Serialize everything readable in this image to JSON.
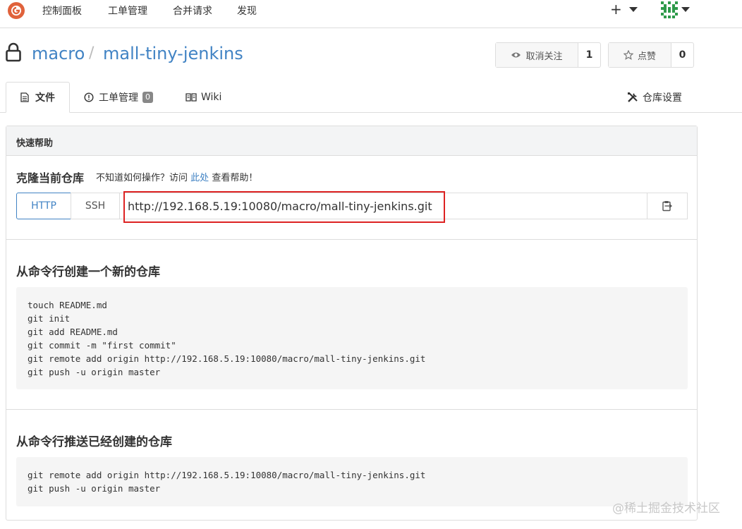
{
  "nav": {
    "items": [
      "控制面板",
      "工单管理",
      "合并请求",
      "发现"
    ],
    "plus": "+"
  },
  "repo": {
    "owner": "macro",
    "separator": "/",
    "name": "mall-tiny-jenkins"
  },
  "actions": {
    "watch_label": "取消关注",
    "watch_count": "1",
    "star_label": "点赞",
    "star_count": "0"
  },
  "tabs": {
    "files": "文件",
    "issues": "工单管理",
    "issues_count": "0",
    "wiki": "Wiki",
    "settings": "仓库设置"
  },
  "quick_help": {
    "header": "快速帮助",
    "clone_title": "克隆当前仓库",
    "hint_prefix": "不知道如何操作？访问",
    "hint_link": "此处",
    "hint_suffix": "查看帮助！",
    "protocols": [
      "HTTP",
      "SSH"
    ],
    "active_protocol": "HTTP",
    "clone_url": "http://192.168.5.19:10080/macro/mall-tiny-jenkins.git"
  },
  "new_repo": {
    "title": "从命令行创建一个新的仓库",
    "lines": [
      "touch README.md",
      "git init",
      "git add README.md",
      "git commit -m \"first commit\"",
      "git remote add origin http://192.168.5.19:10080/macro/mall-tiny-jenkins.git",
      "git push -u origin master"
    ]
  },
  "push_existing": {
    "title": "从命令行推送已经创建的仓库",
    "lines": [
      "git remote add origin http://192.168.5.19:10080/macro/mall-tiny-jenkins.git",
      "git push -u origin master"
    ]
  },
  "watermark": "@稀土掘金技术社区",
  "colors": {
    "link": "#4183c4",
    "highlight": "#dd2222",
    "logo": "#e0623b"
  }
}
